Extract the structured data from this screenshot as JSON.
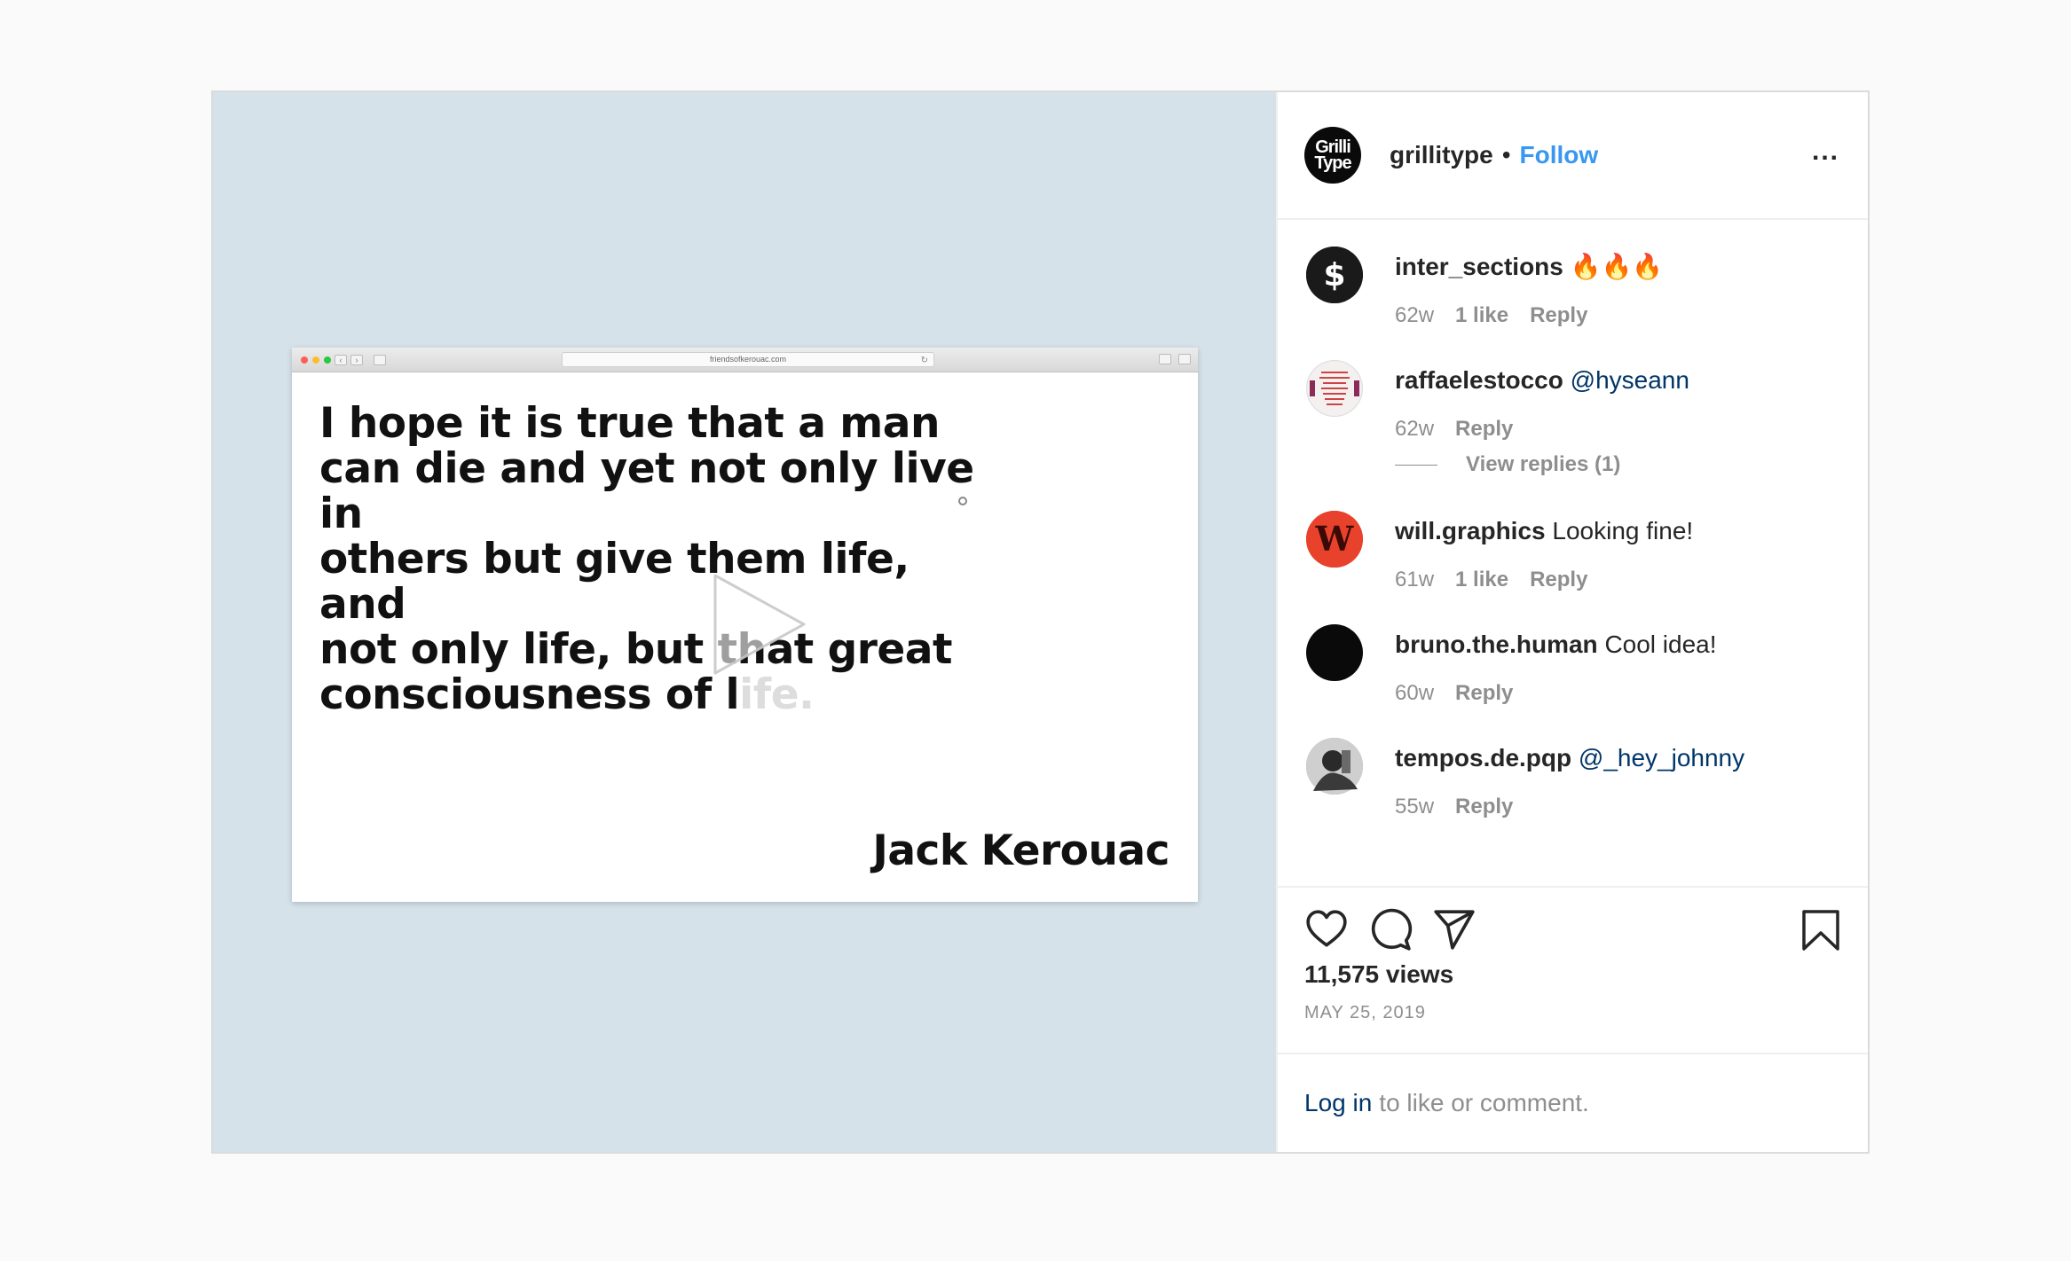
{
  "media": {
    "url_text": "friendsofkerouac.com",
    "quote_lines": [
      "I hope it is true that a man",
      "can die and yet not only live in",
      "others but give them life, and",
      "not only life, but that great",
      "consciousness of life."
    ],
    "author": "Jack Kerouac",
    "colors": {
      "background": "#d5e2ea"
    }
  },
  "header": {
    "avatar_text_1": "Grilli",
    "avatar_text_2": "Type",
    "username": "grillitype",
    "separator": "•",
    "follow": "Follow",
    "more": "..."
  },
  "comments": [
    {
      "username": "inter_sections",
      "text": "🔥🔥🔥",
      "time": "62w",
      "likes": "1 like",
      "reply": "Reply",
      "avatar": "dollar-logo-icon"
    },
    {
      "username": "raffaelestocco",
      "text": "@hyseann",
      "mention": true,
      "time": "62w",
      "likes": "",
      "reply": "Reply",
      "avatar": "poster-thumbnail"
    },
    {
      "username": "will.graphics",
      "text": "Looking fine!",
      "time": "61w",
      "likes": "1 like",
      "reply": "Reply",
      "avatar": "w-logo-icon"
    },
    {
      "username": "bruno.the.human",
      "text": "Cool idea!",
      "time": "60w",
      "likes": "",
      "reply": "Reply",
      "avatar": "black-circle"
    },
    {
      "username": "tempos.de.pqp",
      "text": "@_hey_johnny",
      "mention": true,
      "time": "55w",
      "likes": "",
      "reply": "Reply",
      "avatar": "photo-thumbnail"
    }
  ],
  "view_replies": "View replies (1)",
  "footer": {
    "views": "11,575 views",
    "date": "MAY 25, 2019",
    "login_link": "Log in",
    "login_rest": "to like or comment."
  }
}
